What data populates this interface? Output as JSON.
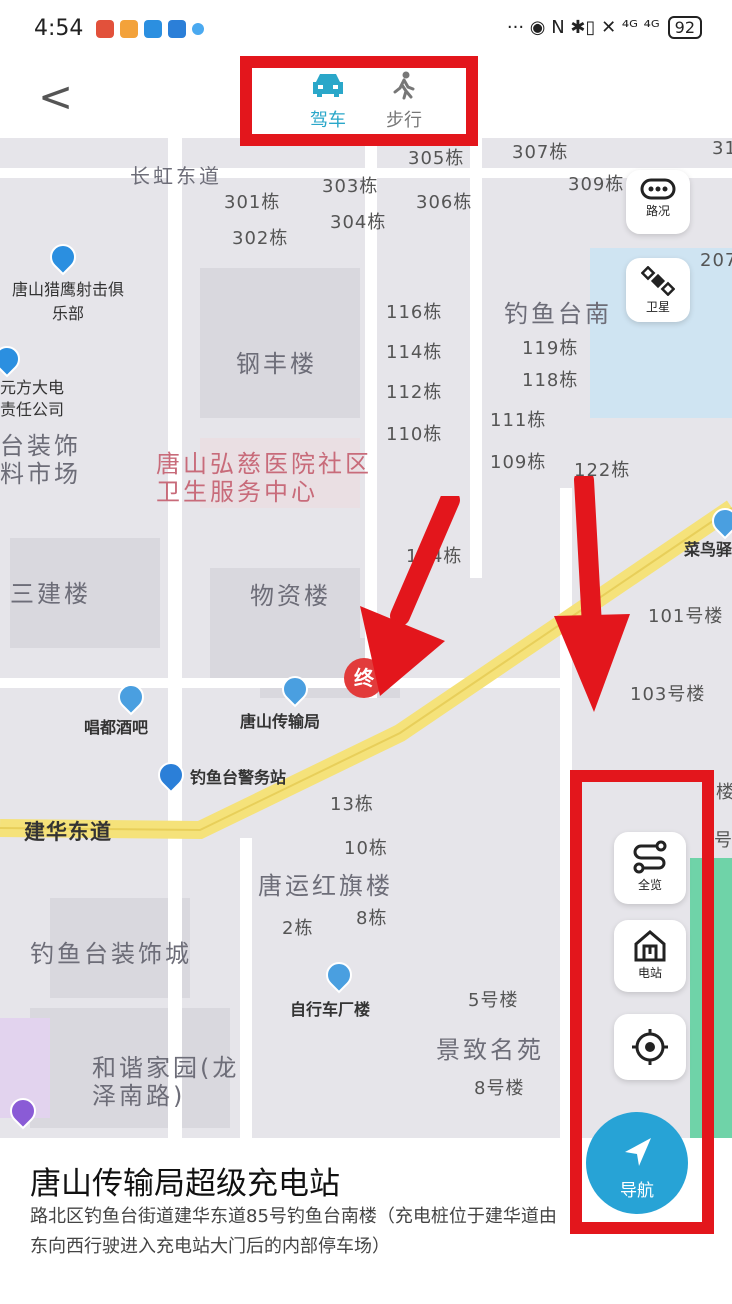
{
  "status": {
    "time": "4:54",
    "icons": "··· ◉ N ✱▯ ✕ ⁴ᴳ ⁴ᴳ",
    "battery": "92"
  },
  "header": {
    "back_label": "<",
    "modes": [
      {
        "label": "驾车",
        "icon": "car-icon",
        "active": true
      },
      {
        "label": "步行",
        "icon": "walk-icon",
        "active": false
      }
    ]
  },
  "map": {
    "labels": [
      "长虹东道",
      "305栋",
      "307栋",
      "31",
      "301栋",
      "303栋",
      "309栋",
      "306栋",
      "304栋",
      "302栋",
      "207",
      "116栋",
      "钓鱼台南",
      "114栋",
      "119栋",
      "钢丰楼",
      "112栋",
      "118栋",
      "110栋",
      "111栋",
      "109栋",
      "122栋",
      "104栋",
      "物资楼",
      "三建楼",
      "101号楼",
      "103号楼",
      "13栋",
      "10栋",
      "唐运红旗楼",
      "2栋",
      "8栋",
      "钓鱼台装饰城",
      "5号楼",
      "景致名苑",
      "8号楼",
      "建华东道",
      "台装饰",
      "料市场",
      "元方大电",
      "责任公司",
      "楼",
      "号"
    ],
    "hospital": "唐山弘慈医院社区卫生服务中心",
    "harmony": "和谐家园(龙泽南路)",
    "pois": [
      "唐山猎鹰射击俱乐部",
      "唱都酒吧",
      "唐山传输局",
      "钓鱼台警务站",
      "自行车厂楼",
      "菜鸟驿"
    ],
    "dest_marker": "终"
  },
  "controls": {
    "traffic": "路况",
    "satellite": "卫星",
    "overview": "全览",
    "station": "电站",
    "locate_icon": "locate-icon",
    "navigate": "导航"
  },
  "place": {
    "name": "唐山传输局超级充电站",
    "address": "路北区钓鱼台街道建华东道85号钓鱼台南楼（充电桩位于建华道由东向西行驶进入充电站大门后的内部停车场）"
  },
  "colors": {
    "accent": "#27a3d6",
    "highlight": "#e3161c",
    "main_road": "#f5e27a"
  }
}
